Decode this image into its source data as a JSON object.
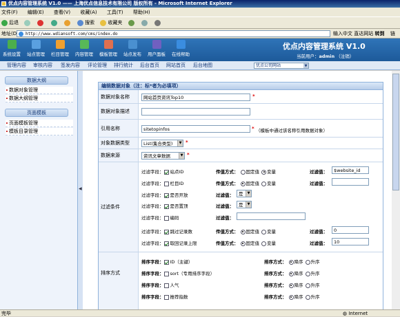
{
  "window": {
    "title": "优点内容管理系统 V1.0 —— 上海优点信息技术有限公司 版权所有 - Microsoft Internet Explorer"
  },
  "menu": [
    "文件(F)",
    "编辑(E)",
    "查看(V)",
    "收藏(A)",
    "工具(T)",
    "帮助(H)"
  ],
  "toolbar": {
    "back": "后退",
    "search": "搜索",
    "favorites": "收藏夹"
  },
  "address": {
    "label": "地址(D)",
    "url": "http://www.wdiansoft.com/cms/index.do",
    "input_hint": "输入中文 直达网站",
    "go": "转到",
    "links": "链"
  },
  "header_icons": [
    {
      "label": "系统设置",
      "color": "#4cae4c"
    },
    {
      "label": "站点管理",
      "color": "#5aa0e0"
    },
    {
      "label": "栏目管理",
      "color": "#f0a030"
    },
    {
      "label": "内容管理",
      "color": "#58b858"
    },
    {
      "label": "模板管理",
      "color": "#e07050"
    },
    {
      "label": "站点发布",
      "color": "#4a90d0"
    },
    {
      "label": "用户面板",
      "color": "#7060c0"
    },
    {
      "label": "在线帮助",
      "color": "#3a8de0"
    }
  ],
  "app": {
    "title": "优点内容管理系统 V1.0",
    "user_label": "当前用户：",
    "user": "admin",
    "logout": "（注销）"
  },
  "nav": [
    "管理内容",
    "审核内容",
    "签发内容",
    "评论管理",
    "排行统计",
    "后台首页",
    "网站首页",
    "后台地图"
  ],
  "site_select": "优点公司网站",
  "sidebar": {
    "sections": [
      {
        "title": "数据大纲",
        "items": [
          "数据对象管理",
          "数据大纲管理"
        ]
      },
      {
        "title": "页面模板",
        "items": [
          "页面模板管理",
          "模板目录管理"
        ]
      }
    ]
  },
  "form": {
    "heading": "编辑数据对象（注：标*者为必填项）",
    "rows": {
      "name": {
        "label": "数据对象名称",
        "value": "网站首页资讯Top10"
      },
      "desc": {
        "label": "数据对象描述",
        "value": ""
      },
      "ref": {
        "label": "引用名称",
        "value": "sitetopinfos",
        "note": "（模板中通过该名称引用数据对象）"
      },
      "type": {
        "label": "对象数据类型",
        "value": "List(集合类型)"
      },
      "source": {
        "label": "数据来源",
        "value": "资讯文章数据"
      },
      "filter": {
        "label": "过滤条件"
      },
      "sort": {
        "label": "排序方式"
      }
    },
    "filter_field_label": "过滤字段：",
    "pass_label": "传值方式：",
    "filter_value_label": "过滤值：",
    "fixed": "固定值",
    "variable": "变量",
    "filters": [
      {
        "field": "站点ID",
        "checked": true,
        "mode": "variable",
        "value": "$website_id"
      },
      {
        "field": "栏目ID",
        "checked": false,
        "mode": "fixed",
        "value": ""
      },
      {
        "field": "是否开放",
        "checked": true,
        "select": "是"
      },
      {
        "field": "是否置顶",
        "checked": true,
        "select": "是"
      },
      {
        "field": "编码",
        "checked": false,
        "text": ""
      },
      {
        "field": "跳过记录数",
        "checked": true,
        "mode": "fixed",
        "value": "0"
      },
      {
        "field": "取回记录上限",
        "checked": true,
        "mode": "fixed",
        "value": "10"
      }
    ],
    "sort_field_label": "排序字段：",
    "sort_mode_label": "排序方式：",
    "desc_label": "降序",
    "asc_label": "升序",
    "sorts": [
      {
        "field": "ID（主键）",
        "checked": true
      },
      {
        "field": "sort（专用排序字段）",
        "checked": false
      },
      {
        "field": "人气",
        "checked": false
      },
      {
        "field": "推荐指数",
        "checked": false
      }
    ]
  },
  "status": {
    "left": "完毕",
    "zone": "Internet"
  }
}
